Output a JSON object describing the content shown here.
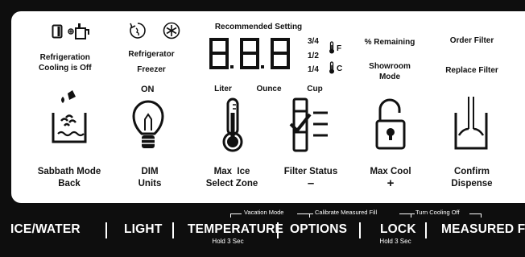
{
  "status": {
    "cooling_off": "Refrigeration\nCooling is Off",
    "refrigerator": "Refrigerator",
    "freezer": "Freezer",
    "recommended": "Recommended Setting",
    "display_digits": "8.8.8",
    "fractions": [
      "3/4",
      "1/2",
      "1/4"
    ],
    "unit_f": "F",
    "unit_c": "C",
    "volume_units": [
      "Liter",
      "Ounce",
      "Cup"
    ],
    "percent_remaining": "% Remaining",
    "showroom_mode": "Showroom\nMode",
    "order_filter": "Order Filter",
    "replace_filter": "Replace Filter"
  },
  "buttons": {
    "sabbath": {
      "line1": "Sabbath Mode",
      "line2": "Back"
    },
    "dim": {
      "line1": "DIM",
      "line2": "Units",
      "top": "ON"
    },
    "max_ice": {
      "line1": "Max  Ice",
      "line2": "Select Zone"
    },
    "filter": {
      "line1": "Filter Status",
      "line2": "–"
    },
    "max_cool": {
      "line1": "Max Cool",
      "line2": "+"
    },
    "confirm": {
      "line1": "Confirm",
      "line2": "Dispense"
    }
  },
  "hold_labels": {
    "vacation": "Vacation Mode",
    "calibrate": "Calibrate Measured Fill",
    "turn_cooling": "Turn Cooling Off"
  },
  "bar": {
    "ice_water": "ICE/WATER",
    "light": "LIGHT",
    "temperature": "TEMPERATURE",
    "temperature_sub": "Hold 3 Sec",
    "options": "OPTIONS",
    "lock": "LOCK",
    "lock_sub": "Hold 3 Sec",
    "measured_fill": "MEASURED FILL"
  },
  "icons": [
    "door-icon",
    "ice-dispenser-icon",
    "refrigerator-snowflake-icon",
    "freezer-snowflake-icon",
    "thermometer-f-icon",
    "thermometer-c-icon",
    "sabbath-candle-icon",
    "lightbulb-icon",
    "max-ice-thermometer-icon",
    "filter-status-icon",
    "padlock-icon",
    "confirm-dispense-icon"
  ]
}
